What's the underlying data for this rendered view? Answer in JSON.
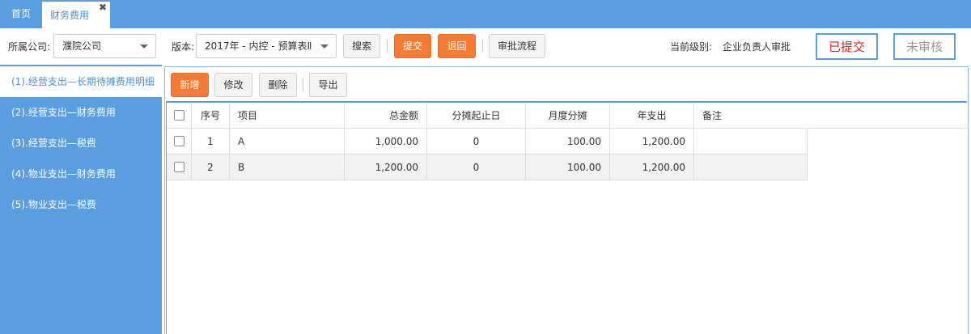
{
  "tabs": {
    "home": "首页",
    "active": "财务费用",
    "close_glyph": "✖"
  },
  "toolbar": {
    "company_label": "所属公司:",
    "company_value": "濮院公司",
    "version_label": "版本:",
    "version_value": "2017年 - 内控 - 预算表Ⅱ",
    "search": "搜索",
    "submit": "提交",
    "return": "退回",
    "approval_flow": "审批流程",
    "level_label": "当前级别:",
    "level_value": "企业负责人审批",
    "status_submitted": "已提交",
    "status_unreviewed": "未审核"
  },
  "sidebar": {
    "items": [
      {
        "label": "(1).经营支出—长期待摊费用明细"
      },
      {
        "label": "(2).经营支出—财务费用"
      },
      {
        "label": "(3).经营支出—税费"
      },
      {
        "label": "(4).物业支出—财务费用"
      },
      {
        "label": "(5).物业支出—税费"
      }
    ]
  },
  "actions": {
    "add": "新增",
    "edit": "修改",
    "delete": "删除",
    "export": "导出"
  },
  "table": {
    "headers": [
      "序号",
      "项目",
      "总金额",
      "分摊起止日",
      "月度分摊",
      "年支出",
      "备注"
    ],
    "rows": [
      {
        "no": "1",
        "item": "A",
        "total": "1,000.00",
        "period": "0",
        "monthly": "100.00",
        "annual": "1,200.00",
        "remark": ""
      },
      {
        "no": "2",
        "item": "B",
        "total": "1,200.00",
        "period": "0",
        "monthly": "100.00",
        "annual": "1,200.00",
        "remark": ""
      }
    ]
  },
  "colors": {
    "accent": "#5b9ee0",
    "orange": "#f47b35",
    "red": "#e02020"
  }
}
